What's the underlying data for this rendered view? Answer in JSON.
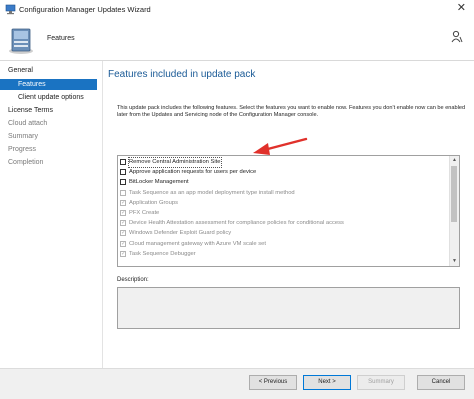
{
  "window": {
    "title": "Configuration Manager Updates Wizard",
    "close_glyph": "✕"
  },
  "header": {
    "page_title": "Features"
  },
  "nav": {
    "items": [
      {
        "label": "General"
      },
      {
        "label": "Features"
      },
      {
        "label": "Client update options"
      },
      {
        "label": "License Terms"
      },
      {
        "label": "Cloud attach"
      },
      {
        "label": "Summary"
      },
      {
        "label": "Progress"
      },
      {
        "label": "Completion"
      }
    ]
  },
  "main": {
    "heading": "Features included in update pack",
    "description": "This update pack includes the following features. Select the features you want to enable now. Features you don't enable now can be enabled later from the Updates and Servicing node of the Configuration Manager console.",
    "features": [
      {
        "label": "Remove Central Administration Site",
        "checked": false,
        "enabled": true
      },
      {
        "label": "Approve application requests for users per device",
        "checked": false,
        "enabled": true
      },
      {
        "label": "BitLocker Management",
        "checked": false,
        "enabled": true
      },
      {
        "label": "Task Sequence as an app model deployment type install method",
        "checked": false,
        "enabled": false
      },
      {
        "label": "Application Groups",
        "checked": true,
        "enabled": false
      },
      {
        "label": "PFX Create",
        "checked": true,
        "enabled": false
      },
      {
        "label": "Device Health Attestation assessment for compliance policies for conditional access",
        "checked": true,
        "enabled": false
      },
      {
        "label": "Windows Defender Exploit Guard policy",
        "checked": true,
        "enabled": false
      },
      {
        "label": "Cloud management gateway with Azure VM scale set",
        "checked": true,
        "enabled": false
      },
      {
        "label": "Task Sequence Debugger",
        "checked": true,
        "enabled": false
      }
    ],
    "description_label": "Description:",
    "description_value": ""
  },
  "footer": {
    "previous_label": "< Previous",
    "next_label": "Next >",
    "summary_label": "Summary",
    "cancel_label": "Cancel"
  },
  "icons": {
    "app": "computer-icon",
    "header": "server-icon",
    "help": "person-help-icon",
    "annotation": "red-arrow"
  },
  "colors": {
    "accent": "#1a73c2",
    "heading": "#1a5a96",
    "annotation": "#e0312b"
  }
}
